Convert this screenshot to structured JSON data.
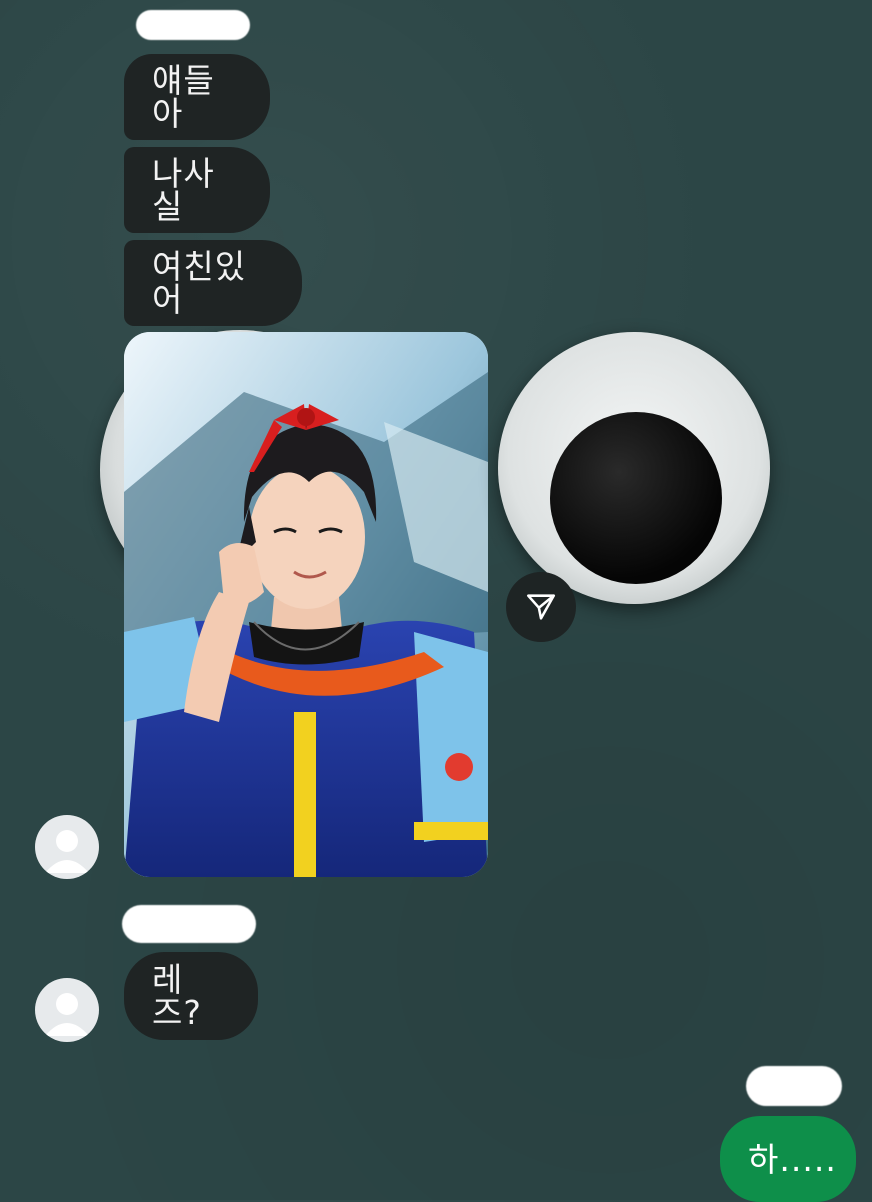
{
  "chat": {
    "messages": [
      {
        "text": "얘들아"
      },
      {
        "text": "나사실"
      },
      {
        "text": "여친있어"
      },
      {
        "text": "레즈?"
      },
      {
        "text": "하....."
      }
    ]
  },
  "icons": {
    "share": "share-send-icon",
    "avatar": "default-avatar-icon"
  },
  "colors": {
    "background": "#2c4646",
    "incoming_bubble": "#1f2424",
    "outgoing_bubble": "#0e8f4a",
    "text_on_bubble": "#f2f2f2"
  }
}
